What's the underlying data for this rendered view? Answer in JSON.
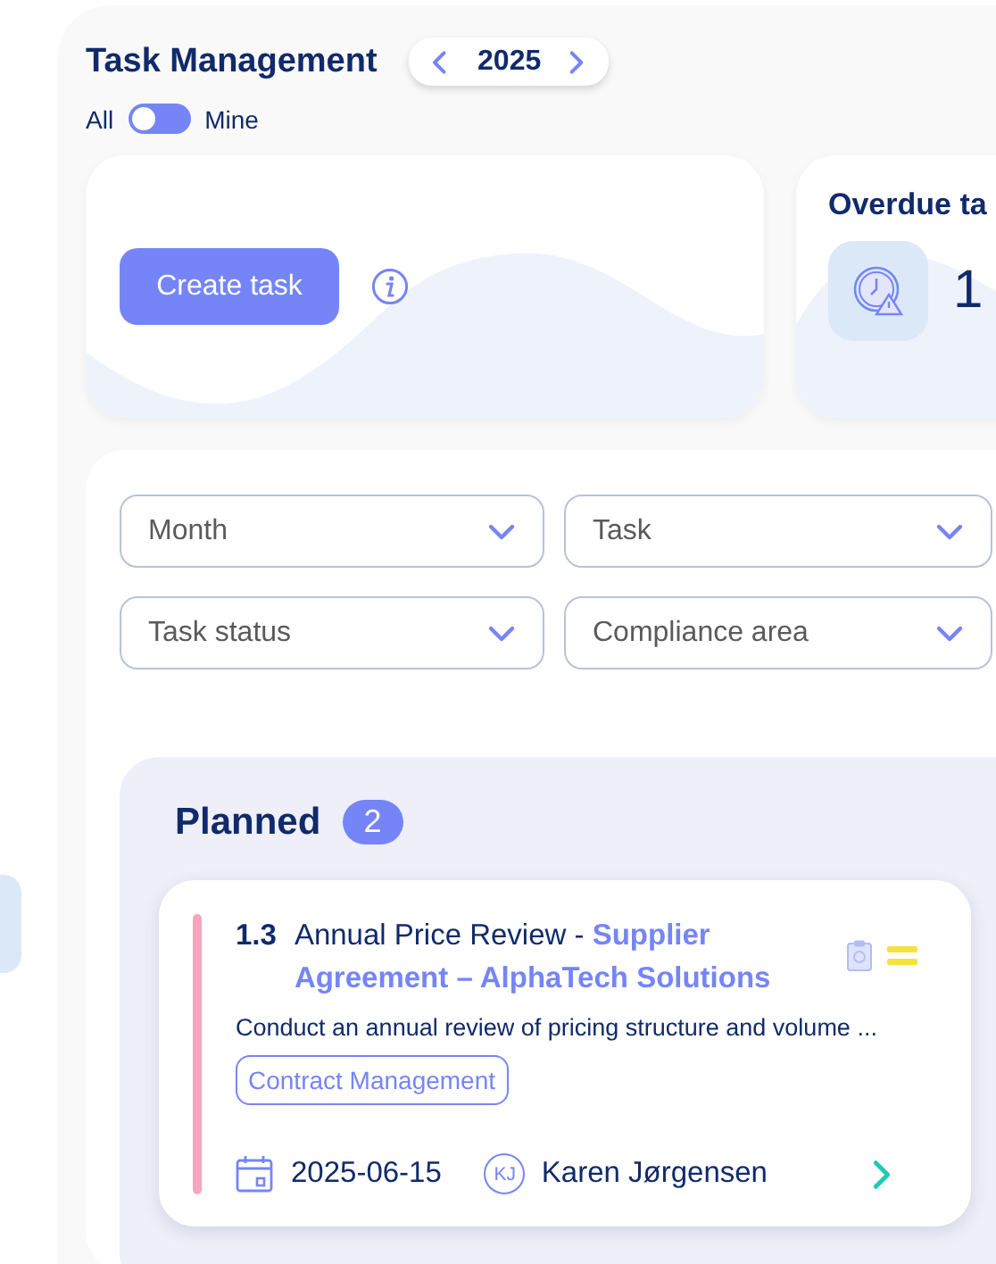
{
  "header": {
    "title": "Task Management",
    "year": "2025"
  },
  "scope_toggle": {
    "left_label": "All",
    "right_label": "Mine",
    "on": false
  },
  "create_card": {
    "button": "Create task"
  },
  "overdue_card": {
    "title": "Overdue ta",
    "count": "1"
  },
  "filters": [
    {
      "placeholder": "Month"
    },
    {
      "placeholder": "Task"
    },
    {
      "placeholder": "Task status"
    },
    {
      "placeholder": "Compliance area"
    }
  ],
  "columns": [
    {
      "title": "Planned",
      "count": "2",
      "tasks": [
        {
          "number": "1.3",
          "title": "Annual Price Review - **Supplier Agreement – AlphaTech Solutions**",
          "description": "Conduct an annual review of pricing structure and volume ...",
          "area": "Contract Management",
          "due_date": "2025-06-15",
          "assignee": {
            "initials": "KJ",
            "name": "Karen Jørgensen"
          },
          "kind": "medium",
          "color": "#f8a5bf"
        }
      ]
    }
  ]
}
